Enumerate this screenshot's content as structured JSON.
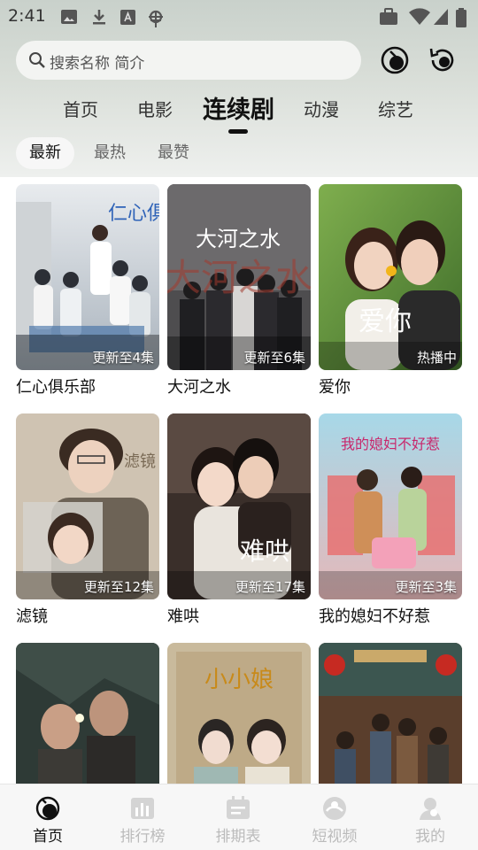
{
  "status_bar": {
    "time": "2:41"
  },
  "search": {
    "placeholder": "搜索名称 简介"
  },
  "tabs": [
    {
      "label": "首页"
    },
    {
      "label": "电影"
    },
    {
      "label": "连续剧",
      "active": true
    },
    {
      "label": "动漫"
    },
    {
      "label": "综艺"
    }
  ],
  "sort": [
    {
      "label": "最新",
      "active": true
    },
    {
      "label": "最热"
    },
    {
      "label": "最赞"
    }
  ],
  "items": [
    {
      "title": "仁心俱乐部",
      "badge": "更新至4集",
      "poster_text": "仁心俱乐部"
    },
    {
      "title": "大河之水",
      "badge": "更新至6集",
      "poster_text": "大河之水"
    },
    {
      "title": "爱你",
      "badge": "热播中",
      "poster_text": "爱你"
    },
    {
      "title": "滤镜",
      "badge": "更新至12集",
      "poster_text": "滤镜"
    },
    {
      "title": "难哄",
      "badge": "更新至17集",
      "poster_text": "难哄"
    },
    {
      "title": "我的媳妇不好惹",
      "badge": "更新至3集",
      "poster_text": "我的媳妇不好惹"
    },
    {
      "title": "",
      "badge": "",
      "poster_text": ""
    },
    {
      "title": "",
      "badge": "",
      "poster_text": "小小娘"
    },
    {
      "title": "",
      "badge": "",
      "poster_text": ""
    }
  ],
  "bottom_nav": [
    {
      "label": "首页",
      "icon": "home-icon",
      "active": true
    },
    {
      "label": "排行榜",
      "icon": "ranking-icon"
    },
    {
      "label": "排期表",
      "icon": "calendar-icon"
    },
    {
      "label": "短视频",
      "icon": "short-video-icon"
    },
    {
      "label": "我的",
      "icon": "profile-icon"
    }
  ],
  "colors": {
    "accent": "#111111",
    "inactive": "#bbbbbb",
    "header_bg": "#d4dad4"
  }
}
